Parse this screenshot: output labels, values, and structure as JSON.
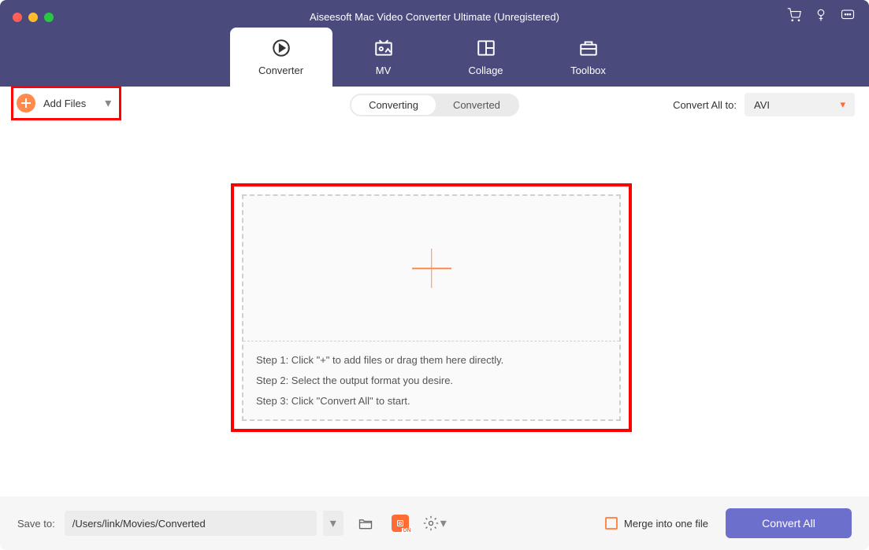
{
  "app_title": "Aiseesoft Mac Video Converter Ultimate (Unregistered)",
  "nav": {
    "converter": "Converter",
    "mv": "MV",
    "collage": "Collage",
    "toolbox": "Toolbox"
  },
  "toolbar": {
    "add_files_label": "Add Files",
    "segments": {
      "converting": "Converting",
      "converted": "Converted"
    },
    "convert_all_to_label": "Convert All to:",
    "format_selected": "AVI"
  },
  "steps": {
    "s1": "Step 1: Click \"+\" to add files or drag them here directly.",
    "s2": "Step 2: Select the output format you desire.",
    "s3": "Step 3: Click \"Convert All\" to start."
  },
  "footer": {
    "save_to_label": "Save to:",
    "save_path": "/Users/link/Movies/Converted",
    "merge_label": "Merge into one file",
    "convert_all_label": "Convert All"
  }
}
